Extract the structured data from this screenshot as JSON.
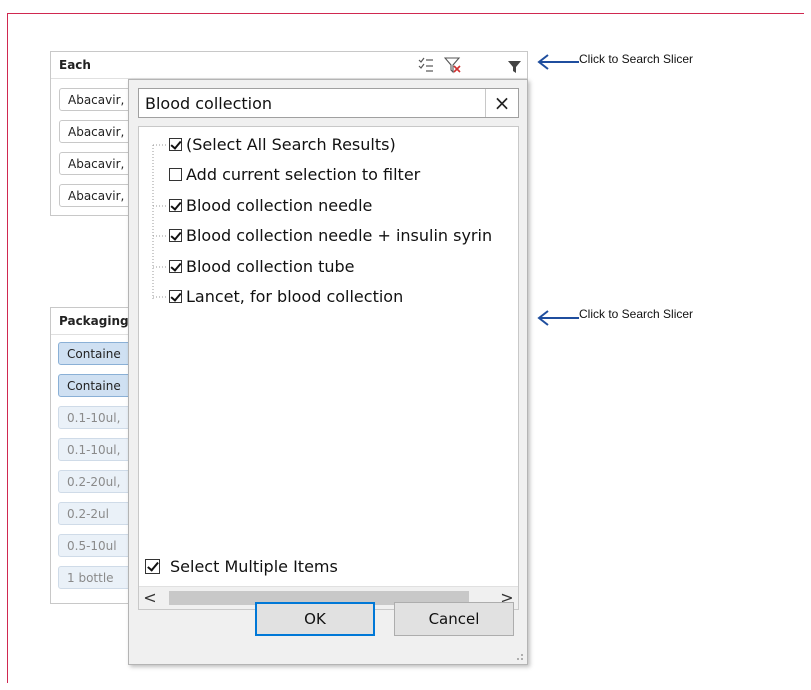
{
  "slicer_each": {
    "title": "Each",
    "items": [
      "Abacavir,",
      "Abacavir,",
      "Abacavir,",
      "Abacavir,"
    ]
  },
  "slicer_packaging": {
    "title": "Packaging",
    "items": [
      {
        "label": "Containe",
        "state": "selected"
      },
      {
        "label": "Containe",
        "state": "selected"
      },
      {
        "label": "0.1-10ul,",
        "state": "dim"
      },
      {
        "label": "0.1-10ul,",
        "state": "dim"
      },
      {
        "label": "0.2-20ul,",
        "state": "dim"
      },
      {
        "label": "0.2-2ul",
        "state": "dim"
      },
      {
        "label": "0.5-10ul",
        "state": "dim"
      },
      {
        "label": "1 bottle",
        "state": "dim"
      }
    ]
  },
  "annotations": {
    "top": "Click to Search Slicer",
    "bottom": "Click to Search Slicer"
  },
  "dialog": {
    "search_value": "Blood collection",
    "clear_label": "×",
    "items": [
      {
        "label": "(Select All Search Results)",
        "checked": true
      },
      {
        "label": "Add current selection to filter",
        "checked": false
      },
      {
        "label": "Blood collection needle",
        "checked": true
      },
      {
        "label": "Blood collection needle + insulin syrin",
        "checked": true
      },
      {
        "label": "Blood collection tube",
        "checked": true
      },
      {
        "label": "Lancet, for blood collection",
        "checked": true
      }
    ],
    "scroll_left": "<",
    "scroll_right": ">",
    "multi_select_label": "Select Multiple Items",
    "multi_select_checked": true,
    "ok_label": "OK",
    "cancel_label": "Cancel"
  },
  "colors": {
    "frame_border": "#d02850",
    "selected_fill": "#cfe0f2",
    "arrow_blue": "#1f4e9e",
    "ok_border": "#0078d7"
  }
}
